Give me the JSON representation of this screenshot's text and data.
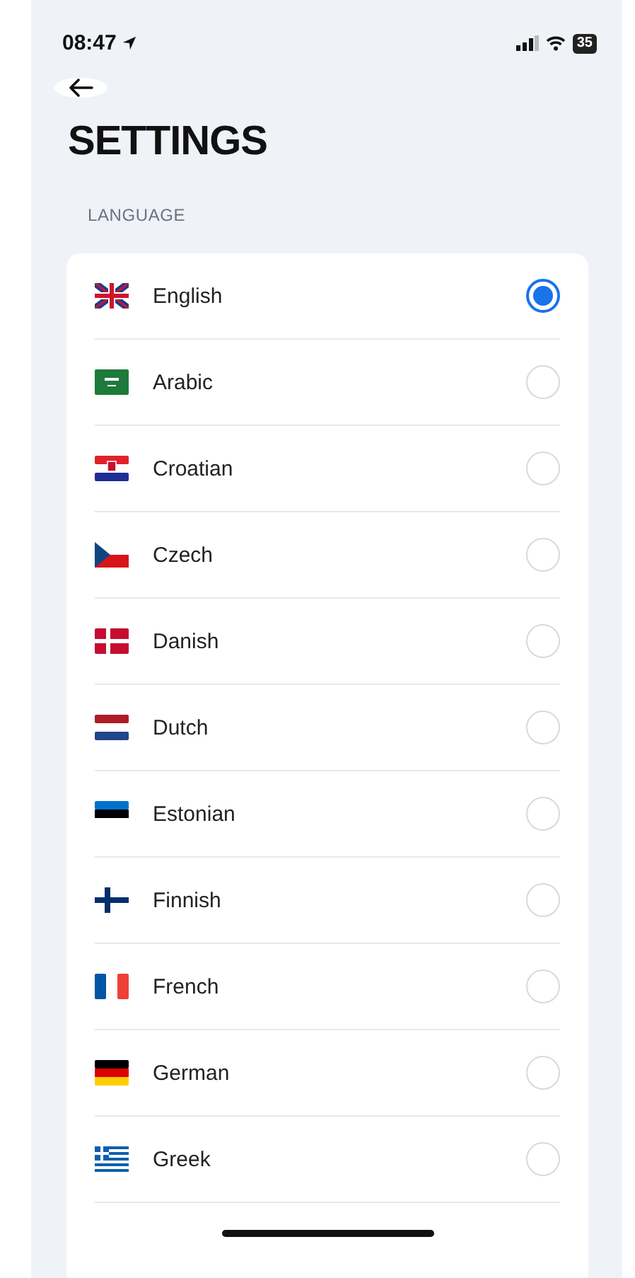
{
  "status_bar": {
    "time": "08:47",
    "battery": "35"
  },
  "title": "SETTINGS",
  "section_label": "LANGUAGE",
  "languages": [
    {
      "label": "English",
      "kind": "uk",
      "selected": true
    },
    {
      "label": "Arabic",
      "kind": "sa",
      "selected": false
    },
    {
      "label": "Croatian",
      "kind": "hr",
      "selected": false
    },
    {
      "label": "Czech",
      "kind": "cz",
      "selected": false
    },
    {
      "label": "Danish",
      "kind": "dk",
      "selected": false
    },
    {
      "label": "Dutch",
      "kind": "nl",
      "selected": false
    },
    {
      "label": "Estonian",
      "kind": "ee",
      "selected": false
    },
    {
      "label": "Finnish",
      "kind": "fi",
      "selected": false
    },
    {
      "label": "French",
      "kind": "fr",
      "selected": false
    },
    {
      "label": "German",
      "kind": "de",
      "selected": false
    },
    {
      "label": "Greek",
      "kind": "gr",
      "selected": false
    }
  ]
}
